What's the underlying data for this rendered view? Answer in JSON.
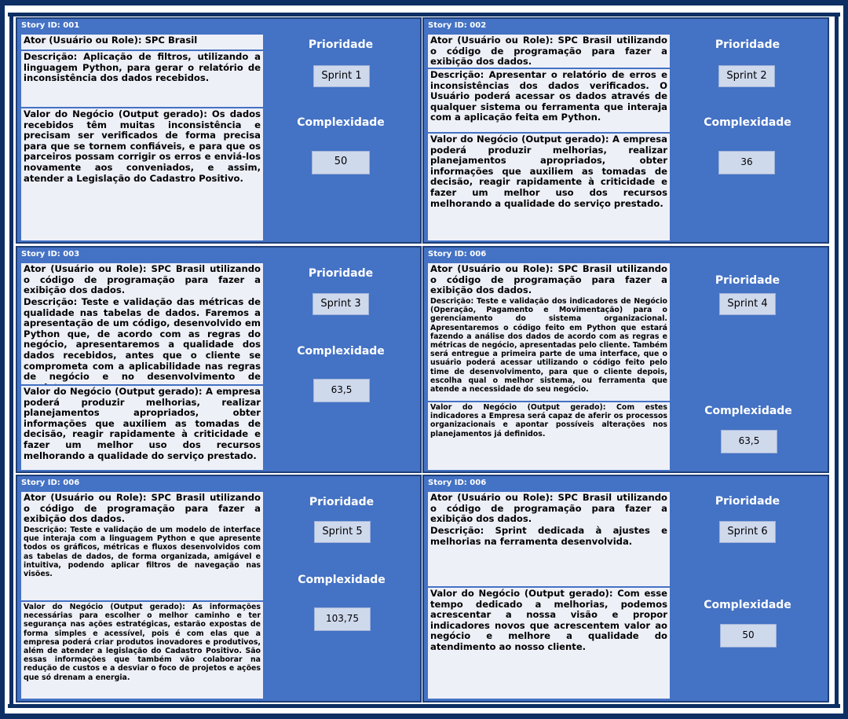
{
  "labels": {
    "priority": "Prioridade",
    "complexity": "Complexidade"
  },
  "cards": [
    {
      "story_id": "Story ID: 001",
      "actor": "Ator (Usuário ou Role): SPC Brasil",
      "description": "Descrição:  Aplicação de filtros, utilizando a linguagem Python, para gerar o relatório de inconsistência dos dados recebidos.",
      "value": "Valor do Negócio (Output gerado): Os dados recebidos têm muitas inconsistência e precisam ser verificados de forma precisa para que se tornem confiáveis, e para que os parceiros possam corrigir os erros e enviá-los novamente aos conveniados, e assim, atender a Legislação do Cadastro Positivo.",
      "sprint": "Sprint 1",
      "complexity": "50"
    },
    {
      "story_id": "Story ID: 002",
      "actor": "Ator (Usuário ou Role): SPC Brasil utilizando o código de programação para fazer a exibição dos dados.",
      "description": "Descrição: Apresentar o relatório de erros e inconsistências dos dados verificados. O Usuário poderá acessar os dados através de qualquer sistema ou ferramenta que interaja com a aplicação feita em Python.",
      "value": "Valor do Negócio (Output gerado): A empresa poderá produzir melhorias, realizar planejamentos apropriados, obter informações que auxiliem as tomadas de decisão, reagir rapidamente à criticidade e fazer um melhor uso dos recursos melhorando a qualidade do serviço prestado.",
      "sprint": "Sprint 2",
      "complexity": "36"
    },
    {
      "story_id": "Story ID: 003",
      "actor": "Ator (Usuário ou Role): SPC Brasil utilizando o código de programação para fazer a exibição dos dados.",
      "description": "Descrição: Teste e validação das métricas de qualidade nas tabelas de dados. Faremos a apresentação de um código, desenvolvido em Python que, de acordo com as regras do negócio, apresentaremos a qualidade dos dados recebidos, antes que o cliente se comprometa com a aplicabilidade nas regras de negócio e no desenvolvimento de produtos.",
      "value": "Valor do Negócio (Output gerado): A empresa poderá produzir melhorias, realizar planejamentos apropriados, obter informações que auxiliem as tomadas de decisão, reagir rapidamente à criticidade e fazer um melhor uso dos recursos melhorando a qualidade do serviço prestado.",
      "sprint": "Sprint 3",
      "complexity": "63,5"
    },
    {
      "story_id": "Story ID: 006",
      "actor": "Ator (Usuário ou Role): SPC Brasil utilizando o código de programação para fazer a exibição dos dados.",
      "description": "Descrição: Teste e validação dos indicadores de Negócio (Operação, Pagamento e Movimentação) para o gerenciamento do sistema organizacional. Apresentaremos o código feito em Python que estará fazendo a análise dos dados de acordo com as regras e métricas de negócio, apresentadas pelo cliente. Também será entregue a primeira parte de uma interface, que o usuário poderá acessar utilizando o código feito pelo time de desenvolvimento, para que o cliente depois, escolha qual o melhor sistema, ou ferramenta que atende a necessidade do seu negócio.",
      "value": "Valor do Negócio (Output gerado): Com estes indicadores a Empresa será capaz de aferir os processos organizacionais e apontar possíveis alterações nos planejamentos já definidos.",
      "sprint": "Sprint 4",
      "complexity": "63,5"
    },
    {
      "story_id": "Story ID: 006",
      "actor": "Ator (Usuário ou Role): SPC Brasil utilizando o código de programação para fazer a exibição dos dados.",
      "description": "Descrição: Teste e validação de um modelo de interface que interaja com a linguagem Python e que apresente todos os gráficos, métricas e fluxos desenvolvidos com as tabelas de dados, de forma organizada, amigável e intuitiva, podendo aplicar filtros de navegação nas visões.",
      "value": "Valor do Negócio (Output gerado): As informações necessárias para escolher o melhor caminho e ter segurança nas ações estratégicas, estarão expostas de forma simples e  acessível, pois é com elas que a empresa poderá criar produtos inovadores e produtivos, além de atender a legislação do Cadastro Positivo. São essas informações que também vão colaborar na redução de custos e a desviar o foco de projetos e ações que só drenam a energia.",
      "sprint": "Sprint 5",
      "complexity": "103,75"
    },
    {
      "story_id": "Story ID: 006",
      "actor": "Ator (Usuário ou Role): SPC Brasil utilizando o código de programação para fazer a exibição dos dados.",
      "description": "Descrição: Sprint dedicada à ajustes e melhorias na ferramenta desenvolvida.",
      "value": "Valor do Negócio (Output gerado): Com esse tempo dedicado a melhorias, podemos acrescentar a nossa visão e propor indicadores novos que acrescentem valor ao negócio e melhore a  qualidade do atendimento ao nosso cliente.",
      "sprint": "Sprint 6",
      "complexity": "50"
    }
  ]
}
